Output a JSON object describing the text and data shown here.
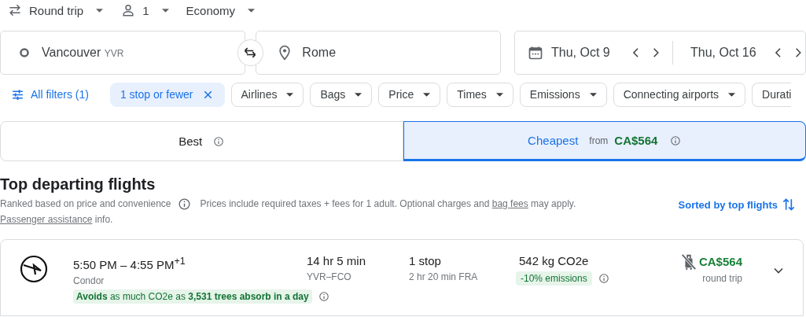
{
  "trip_options": [
    {
      "kind": "trip",
      "label": "Round trip"
    },
    {
      "kind": "passengers",
      "label": "1"
    },
    {
      "kind": "class",
      "label": "Economy"
    }
  ],
  "search": {
    "origin": "Vancouver",
    "origin_code": "YVR",
    "destination": "Rome",
    "depart_date": "Thu, Oct 9",
    "return_date": "Thu, Oct 16"
  },
  "filters": [
    {
      "kind": "all",
      "label": "All filters (1)"
    },
    {
      "kind": "applied",
      "label": "1 stop or fewer"
    },
    {
      "kind": "dropdown",
      "label": "Airlines"
    },
    {
      "kind": "dropdown",
      "label": "Bags"
    },
    {
      "kind": "dropdown",
      "label": "Price"
    },
    {
      "kind": "dropdown",
      "label": "Times"
    },
    {
      "kind": "dropdown",
      "label": "Emissions"
    },
    {
      "kind": "dropdown",
      "label": "Connecting airports"
    },
    {
      "kind": "cut",
      "label": "Durati"
    }
  ],
  "sort_tabs": [
    {
      "label": "Best",
      "selected": false
    },
    {
      "label": "Cheapest",
      "selected": true,
      "prefix": "from",
      "price": "CA$564"
    }
  ],
  "section": {
    "title": "Top departing flights",
    "note": "Ranked based on price and convenience",
    "prices_note": "Prices include required taxes + fees for 1 adult. Optional charges and",
    "bag_fees_link": "bag fees",
    "prices_note_end": "may apply.",
    "assistance_link": "Passenger assistance",
    "assistance_end": "info.",
    "sort_label": "Sorted by top flights"
  },
  "flights": [
    {
      "times": "5:50 PM – 4:55 PM$^{+1}$",
      "airline": "Condor",
      "eco_note": "**Avoids** as much CO2e as **3,531 trees absorb in a day**",
      "duration": "14 hr 5 min",
      "route": "YVR–FCO",
      "stops": "1 stop",
      "layover": "2 hr 20 min FRA",
      "emissions": "542 kg CO2e",
      "emissions_badge": "-10% emissions",
      "no_carry_on": true,
      "price": "CA$564",
      "price_note": "round trip"
    }
  ]
}
